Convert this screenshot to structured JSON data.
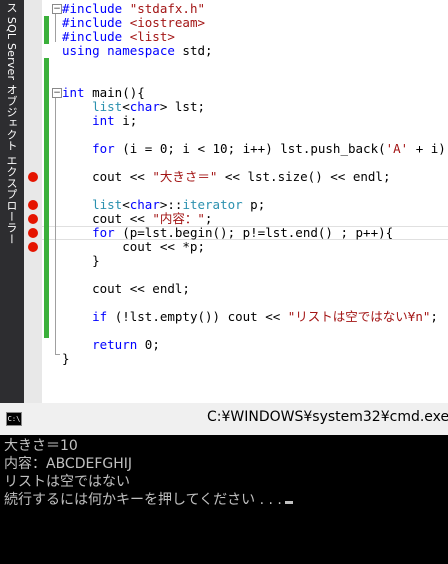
{
  "side_panel": {
    "label": "ス SQL Server オブジェクト エクスプローラー"
  },
  "editor": {
    "lines": [
      {
        "row": 0,
        "tokens": [
          [
            "kw",
            "#include "
          ],
          [
            "str",
            "\"stdafx.h\""
          ]
        ]
      },
      {
        "row": 1,
        "tokens": [
          [
            "kw",
            "#include "
          ],
          [
            "str",
            "<iostream>"
          ]
        ]
      },
      {
        "row": 2,
        "tokens": [
          [
            "kw",
            "#include "
          ],
          [
            "str",
            "<list>"
          ]
        ]
      },
      {
        "row": 3,
        "tokens": [
          [
            "kw",
            "using namespace "
          ],
          [
            "",
            "std;"
          ]
        ]
      },
      {
        "row": 6,
        "tokens": [
          [
            "kw",
            "int "
          ],
          [
            "",
            "main(){"
          ]
        ]
      },
      {
        "row": 7,
        "tokens": [
          [
            "",
            "    "
          ],
          [
            "ty",
            "list"
          ],
          [
            "",
            "<"
          ],
          [
            "kw",
            "char"
          ],
          [
            "",
            "> lst;"
          ]
        ]
      },
      {
        "row": 8,
        "tokens": [
          [
            "",
            "    "
          ],
          [
            "kw",
            "int "
          ],
          [
            "",
            "i;"
          ]
        ]
      },
      {
        "row": 10,
        "tokens": [
          [
            "",
            "    "
          ],
          [
            "kw",
            "for "
          ],
          [
            "",
            "(i = 0; i < 10; i++) lst.push_back("
          ],
          [
            "ch",
            "'A'"
          ],
          [
            "",
            " + i);"
          ]
        ]
      },
      {
        "row": 12,
        "tokens": [
          [
            "",
            "    cout << "
          ],
          [
            "str",
            "\"大きさ＝\""
          ],
          [
            "",
            " << lst.size() << endl;"
          ]
        ]
      },
      {
        "row": 14,
        "tokens": [
          [
            "",
            "    "
          ],
          [
            "ty",
            "list"
          ],
          [
            "",
            "<"
          ],
          [
            "kw",
            "char"
          ],
          [
            "",
            ">::"
          ],
          [
            "ty",
            "iterator"
          ],
          [
            "",
            " p;"
          ]
        ]
      },
      {
        "row": 15,
        "tokens": [
          [
            "",
            "    cout << "
          ],
          [
            "str",
            "\"内容：\""
          ],
          [
            "",
            ";"
          ]
        ]
      },
      {
        "row": 16,
        "tokens": [
          [
            "",
            "    "
          ],
          [
            "kw",
            "for "
          ],
          [
            "",
            "(p=lst.begin(); p!=lst.end() ; p++){"
          ]
        ]
      },
      {
        "row": 17,
        "tokens": [
          [
            "",
            "        cout << *p;"
          ]
        ]
      },
      {
        "row": 18,
        "tokens": [
          [
            "",
            "    }"
          ]
        ]
      },
      {
        "row": 20,
        "tokens": [
          [
            "",
            "    cout << endl;"
          ]
        ]
      },
      {
        "row": 22,
        "tokens": [
          [
            "",
            "    "
          ],
          [
            "kw",
            "if "
          ],
          [
            "",
            "(!lst.empty()) cout << "
          ],
          [
            "str",
            "\"リストは空ではない¥n\""
          ],
          [
            "",
            ";"
          ]
        ]
      },
      {
        "row": 24,
        "tokens": [
          [
            "",
            "    "
          ],
          [
            "kw",
            "return "
          ],
          [
            "",
            "0;"
          ]
        ]
      },
      {
        "row": 25,
        "tokens": [
          [
            "",
            "}"
          ]
        ]
      }
    ],
    "breakpoint_rows": [
      12,
      14,
      15,
      16,
      17
    ],
    "changed_rows": [
      1,
      2,
      4,
      5,
      6,
      7,
      8,
      9,
      10,
      11,
      12,
      13,
      14,
      15,
      16,
      17,
      18,
      19,
      20,
      21,
      22,
      23
    ],
    "fold_rows": [
      0,
      6
    ]
  },
  "cmd": {
    "title": "C:¥WINDOWS¥system32¥cmd.exe",
    "icon_label": "C:\\",
    "output": [
      "大きさ＝10",
      "内容：ABCDEFGHIJ",
      "リストは空ではない",
      "続行するには何かキーを押してください . . ."
    ]
  },
  "colors": {
    "keyword": "#0000ff",
    "type": "#2b91af",
    "string": "#a31515",
    "breakpoint": "#e51400",
    "change_bar": "#3bb03b"
  }
}
